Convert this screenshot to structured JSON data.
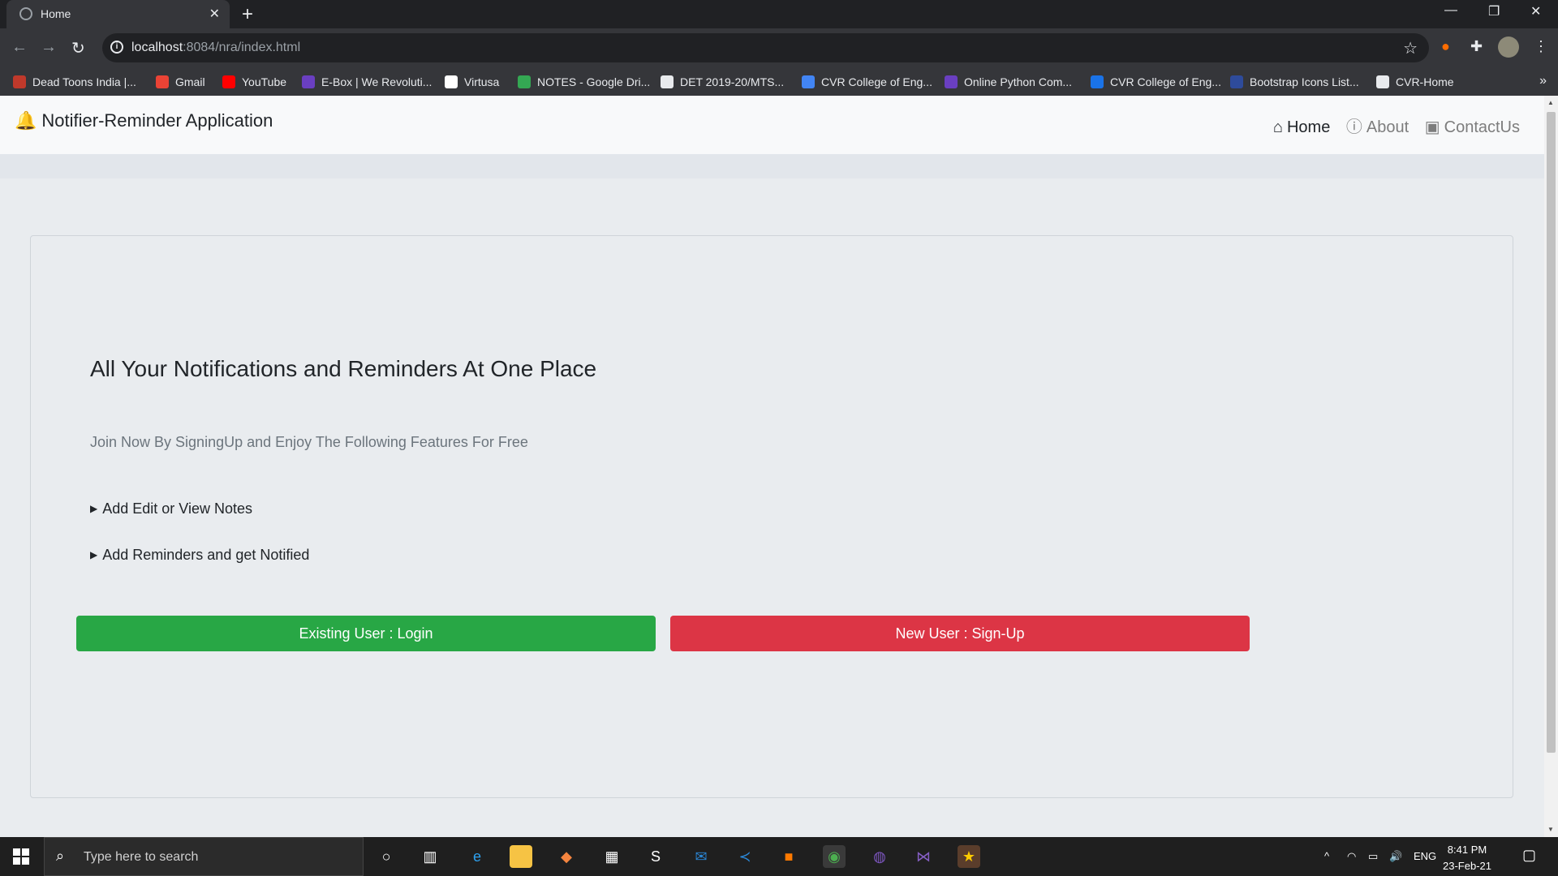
{
  "browser": {
    "tab_title": "Home",
    "url_host": "localhost",
    "url_path": ":8084/nra/index.html",
    "bookmarks": [
      {
        "label": "Dead Toons India |...",
        "icon": "grid-icon",
        "color": "#c0392b"
      },
      {
        "label": "Gmail",
        "icon": "gmail-icon",
        "color": "#ea4335"
      },
      {
        "label": "YouTube",
        "icon": "youtube-icon",
        "color": "#ff0000"
      },
      {
        "label": "E-Box | We Revoluti...",
        "icon": "ebox-icon",
        "color": "#6a3fc1"
      },
      {
        "label": "Virtusa",
        "icon": "virtusa-icon",
        "color": "#ffffff"
      },
      {
        "label": "NOTES - Google Dri...",
        "icon": "drive-icon",
        "color": "#34a853"
      },
      {
        "label": "DET 2019-20/MTS...",
        "icon": "globe-icon",
        "color": "#e8eaed"
      },
      {
        "label": "CVR College of Eng...",
        "icon": "infinity-icon",
        "color": "#4285f4"
      },
      {
        "label": "Online Python Com...",
        "icon": "bolt-icon",
        "color": "#6a3fc1"
      },
      {
        "label": "CVR College of Eng...",
        "icon": "c-icon",
        "color": "#1a73e8"
      },
      {
        "label": "Bootstrap Icons List...",
        "icon": "mdi-icon",
        "color": "#2e4b9b"
      },
      {
        "label": "CVR-Home",
        "icon": "globe-icon",
        "color": "#e8eaed"
      }
    ]
  },
  "app": {
    "brand": "Notifier-Reminder Application",
    "nav": [
      {
        "label": "Home",
        "icon": "home-icon",
        "active": true
      },
      {
        "label": "About",
        "icon": "info-icon",
        "active": false
      },
      {
        "label": "ContactUs",
        "icon": "contact-icon",
        "active": false
      }
    ],
    "heading": "All Your Notifications and Reminders At One Place",
    "subheading": "Join Now By SigningUp and Enjoy The Following Features For Free",
    "features": [
      "Add Edit or View Notes",
      "Add Reminders and get Notified"
    ],
    "login_button": "Existing User : Login",
    "signup_button": "New User : Sign-Up",
    "colors": {
      "login": "#28a745",
      "signup": "#dc3545"
    }
  },
  "taskbar": {
    "search_placeholder": "Type here to search",
    "language": "ENG",
    "time": "8:41 PM",
    "date": "23-Feb-21"
  }
}
